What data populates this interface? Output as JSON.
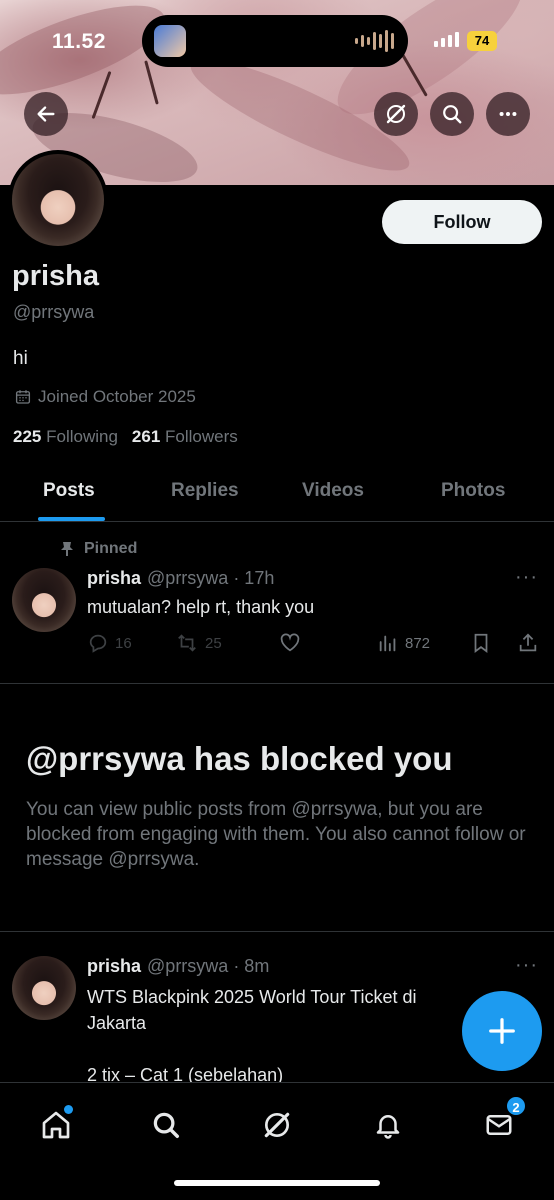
{
  "status_bar": {
    "time": "11.52",
    "battery": "74"
  },
  "profile": {
    "name": "prisha",
    "handle": "@prrsywa",
    "bio": "hi",
    "joined": "Joined October 2025",
    "following_count": "225",
    "following_label": "Following",
    "followers_count": "261",
    "followers_label": "Followers",
    "follow_button": "Follow"
  },
  "tabs": [
    {
      "label": "Posts",
      "active": true
    },
    {
      "label": "Replies",
      "active": false
    },
    {
      "label": "Videos",
      "active": false
    },
    {
      "label": "Photos",
      "active": false
    }
  ],
  "pinned_post": {
    "pinned_label": "Pinned",
    "author": "prisha",
    "handle_time": "@prrsywa · 17h",
    "text": "mutualan? help rt, thank you",
    "replies": "16",
    "reposts": "25",
    "views": "872"
  },
  "blocked": {
    "title": "@prrsywa has blocked you",
    "message": "You can view public posts from @prrsywa, but you are blocked from engaging with them. You also cannot follow or message @prrsywa."
  },
  "second_post": {
    "author": "prisha",
    "handle_time": "@prrsywa · 8m",
    "line1": "WTS Blackpink 2025 World Tour Ticket di",
    "line2": "Jakarta",
    "line3": "2 tix – Cat 1 (sebelahan)"
  },
  "nav": {
    "messages_badge": "2"
  },
  "colors": {
    "accent": "#1d9bf0",
    "background": "#000000",
    "muted": "#71767b"
  }
}
